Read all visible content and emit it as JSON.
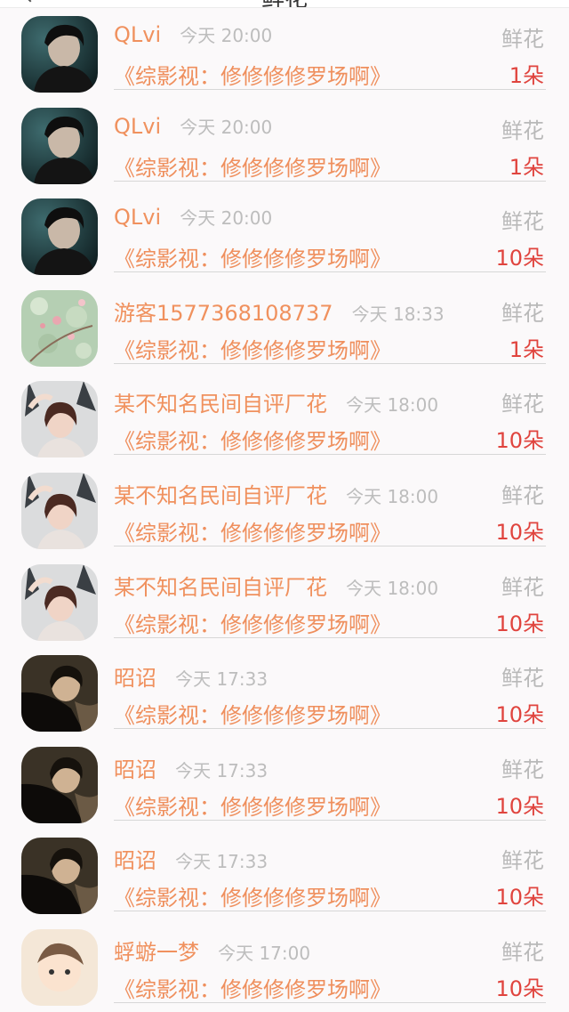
{
  "header": {
    "title": "鲜花"
  },
  "items": [
    {
      "name": "QLvi",
      "time": "今天 20:00",
      "kind": "鲜花",
      "book": "《综影视：修修修修罗场啊》",
      "count": "1朵",
      "avatar": "dark-boy"
    },
    {
      "name": "QLvi",
      "time": "今天 20:00",
      "kind": "鲜花",
      "book": "《综影视：修修修修罗场啊》",
      "count": "1朵",
      "avatar": "dark-boy"
    },
    {
      "name": "QLvi",
      "time": "今天 20:00",
      "kind": "鲜花",
      "book": "《综影视：修修修修罗场啊》",
      "count": "10朵",
      "avatar": "dark-boy"
    },
    {
      "name": "游客1577368108737",
      "time": "今天 18:33",
      "kind": "鲜花",
      "book": "《综影视：修修修修罗场啊》",
      "count": "1朵",
      "avatar": "flowers"
    },
    {
      "name": "某不知名民间自评厂花",
      "time": "今天 18:00",
      "kind": "鲜花",
      "book": "《综影视：修修修修罗场啊》",
      "count": "10朵",
      "avatar": "girl"
    },
    {
      "name": "某不知名民间自评厂花",
      "time": "今天 18:00",
      "kind": "鲜花",
      "book": "《综影视：修修修修罗场啊》",
      "count": "10朵",
      "avatar": "girl"
    },
    {
      "name": "某不知名民间自评厂花",
      "time": "今天 18:00",
      "kind": "鲜花",
      "book": "《综影视：修修修修罗场啊》",
      "count": "10朵",
      "avatar": "girl"
    },
    {
      "name": "昭诏",
      "time": "今天 17:33",
      "kind": "鲜花",
      "book": "《综影视：修修修修罗场啊》",
      "count": "10朵",
      "avatar": "fan-man"
    },
    {
      "name": "昭诏",
      "time": "今天 17:33",
      "kind": "鲜花",
      "book": "《综影视：修修修修罗场啊》",
      "count": "10朵",
      "avatar": "fan-man"
    },
    {
      "name": "昭诏",
      "time": "今天 17:33",
      "kind": "鲜花",
      "book": "《综影视：修修修修罗场啊》",
      "count": "10朵",
      "avatar": "fan-man"
    },
    {
      "name": "蜉蝣一梦",
      "time": "今天 17:00",
      "kind": "鲜花",
      "book": "《综影视：修修修修罗场啊》",
      "count": "10朵",
      "avatar": "cartoon"
    }
  ],
  "colors": {
    "name": "#f0915e",
    "time": "#bdbdbd",
    "count": "#e0443e",
    "background": "#fbf9fa"
  }
}
